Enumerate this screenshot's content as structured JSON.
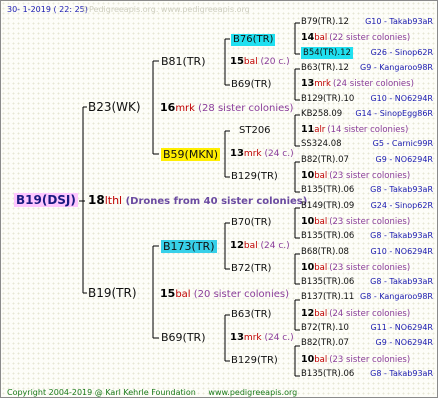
{
  "header": {
    "date": "30- 1-2019 ( 22: 25)",
    "dim_text": "©Pedigreeapis.org. www.pedigreeapis.org"
  },
  "footer": {
    "copyright": "Copyright 2004-2019 @ Karl Kehrle Foundation",
    "site": "www.pedigreeapis.org"
  },
  "root": {
    "name": "B19(DSJ)",
    "brood": "18",
    "abbr": "lthl",
    "note": "(Drones from 40 sister colonies)"
  },
  "gen1": {
    "top": {
      "name": "B23(WK)",
      "brood": "16",
      "abbr": "mrk",
      "sisters": "(28 sister colonies)"
    },
    "bottom": {
      "name": "B19(TR)",
      "brood": "15",
      "abbr": "bal",
      "sisters": "(20 sister colonies)"
    }
  },
  "gen2": {
    "a": {
      "name": "B81(TR)",
      "brood": "15",
      "abbr": "bal",
      "sisters": "(20 c.)"
    },
    "b": {
      "name": "B59(MKN)",
      "brood": "13",
      "abbr": "mrk",
      "sisters": "(24 c.)"
    },
    "c": {
      "name": "B173(TR)",
      "brood": "12",
      "abbr": "bal",
      "sisters": "(24 c.)"
    },
    "d": {
      "name": "B69(TR)",
      "brood": "13",
      "abbr": "mrk",
      "sisters": "(24 c.)"
    }
  },
  "gen3": {
    "a1": "B76(TR)",
    "a2": "B69(TR)",
    "b1": "ST206",
    "b2": "B129(TR)",
    "c1": "B70(TR)",
    "c2": "B72(TR)",
    "d1": "B63(TR)",
    "d2": "B129(TR)"
  },
  "gen4": {
    "r1": {
      "left": "B79(TR).12",
      "right": "G10 - Takab93aR"
    },
    "r2": {
      "brood": "14",
      "abbr": "bal",
      "sisters": "(22 sister colonies)"
    },
    "r3": {
      "left": "B54(TR).12",
      "right": "G26 - Sinop62R"
    },
    "r4": {
      "left": "B63(TR).12",
      "right": "G9 - Kangaroo98R"
    },
    "r5": {
      "brood": "13",
      "abbr": "mrk",
      "sisters": "(24 sister colonies)"
    },
    "r6": {
      "left": "B129(TR).10",
      "right": "G10 - NO6294R"
    },
    "r7": {
      "left": "KB258.09",
      "right": "G14 - SinopEgg86R"
    },
    "r8": {
      "brood": "11",
      "abbr": "alr",
      "sisters": "(14 sister colonies)"
    },
    "r9": {
      "left": "SS324.08",
      "right": "G5 - Carnic99R"
    },
    "r10": {
      "left": "B82(TR).07",
      "right": "G9 - NO6294R"
    },
    "r11": {
      "brood": "10",
      "abbr": "bal",
      "sisters": "(23 sister colonies)"
    },
    "r12": {
      "left": "B135(TR).06",
      "right": "G8 - Takab93aR"
    },
    "r13": {
      "left": "B149(TR).09",
      "right": "G24 - Sinop62R"
    },
    "r14": {
      "brood": "10",
      "abbr": "bal",
      "sisters": "(23 sister colonies)"
    },
    "r15": {
      "left": "B135(TR).06",
      "right": "G8 - Takab93aR"
    },
    "r16": {
      "left": "B68(TR).08",
      "right": "G10 - NO6294R"
    },
    "r17": {
      "brood": "10",
      "abbr": "bal",
      "sisters": "(23 sister colonies)"
    },
    "r18": {
      "left": "B135(TR).06",
      "right": "G8 - Takab93aR"
    },
    "r19": {
      "left": "B137(TR).11",
      "right": "G8 - Kangaroo98R"
    },
    "r20": {
      "brood": "12",
      "abbr": "bal",
      "sisters": "(24 sister colonies)"
    },
    "r21": {
      "left": "B72(TR).10",
      "right": "G11 - NO6294R"
    },
    "r22": {
      "left": "B82(TR).07",
      "right": "G9 - NO6294R"
    },
    "r23": {
      "brood": "10",
      "abbr": "bal",
      "sisters": "(23 sister colonies)"
    },
    "r24": {
      "left": "B135(TR).06",
      "right": "G8 - Takab93aR"
    }
  }
}
